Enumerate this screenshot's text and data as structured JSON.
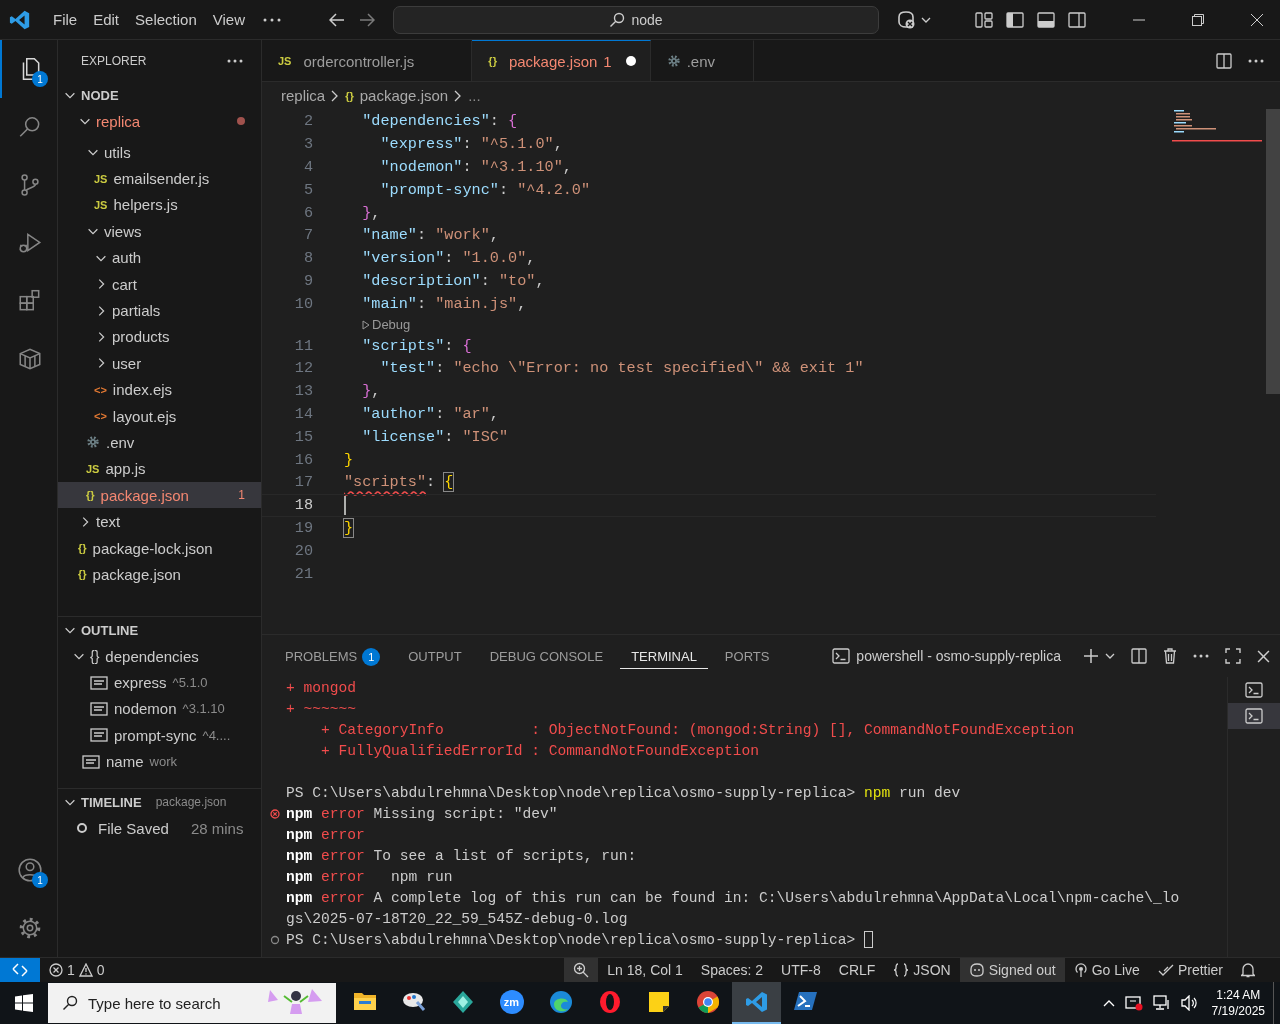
{
  "title_bar": {
    "menu": [
      "File",
      "Edit",
      "Selection",
      "View"
    ],
    "search": "node"
  },
  "activity_bar": {
    "top": [
      {
        "kind": "explorer",
        "selected": true,
        "badge": "1"
      },
      {
        "kind": "search",
        "selected": false
      },
      {
        "kind": "source-control",
        "selected": false
      },
      {
        "kind": "run-debug",
        "selected": false
      },
      {
        "kind": "extensions",
        "selected": false
      },
      {
        "kind": "box",
        "selected": false
      }
    ],
    "bottom": [
      {
        "kind": "accounts",
        "badge": "1"
      },
      {
        "kind": "settings"
      }
    ]
  },
  "explorer": {
    "title": "EXPLORER",
    "section": {
      "label": "NODE",
      "expanded": true
    },
    "tree": [
      {
        "label": "replica",
        "kind": "folder",
        "expanded": true,
        "selected": false,
        "error": true,
        "children": [
          {
            "label": "utils",
            "kind": "folder",
            "expanded": true,
            "selected": false,
            "error": false,
            "children": [
              {
                "label": "emailsender.js",
                "kind": "js",
                "icon": "JS",
                "selected": false,
                "error": false
              },
              {
                "label": "helpers.js",
                "kind": "js",
                "icon": "JS",
                "selected": false,
                "error": false
              }
            ]
          },
          {
            "label": "views",
            "kind": "folder",
            "expanded": true,
            "selected": false,
            "error": false,
            "children": [
              {
                "label": "auth",
                "kind": "folder",
                "expanded": true,
                "selected": false,
                "error": false
              },
              {
                "label": "cart",
                "kind": "folder",
                "expanded": false,
                "selected": false,
                "error": false
              },
              {
                "label": "partials",
                "kind": "folder",
                "expanded": false,
                "selected": false,
                "error": false
              },
              {
                "label": "products",
                "kind": "folder",
                "expanded": false,
                "selected": false,
                "error": false
              },
              {
                "label": "user",
                "kind": "folder",
                "expanded": false,
                "selected": false,
                "error": false
              },
              {
                "label": "index.ejs",
                "kind": "ejs",
                "icon": "<>",
                "selected": false,
                "error": false
              },
              {
                "label": "layout.ejs",
                "kind": "ejs",
                "icon": "<>",
                "selected": false,
                "error": false
              }
            ]
          },
          {
            "label": ".env",
            "kind": "env",
            "selected": false,
            "error": false
          },
          {
            "label": "app.js",
            "kind": "js",
            "icon": "JS",
            "selected": false,
            "error": false
          },
          {
            "label": "package.json",
            "kind": "json",
            "icon": "{}",
            "selected": true,
            "error": true,
            "count": "1"
          }
        ]
      },
      {
        "label": "text",
        "kind": "folder",
        "expanded": false,
        "selected": false,
        "error": false
      },
      {
        "label": "package-lock.json",
        "kind": "json",
        "icon": "{}",
        "selected": false,
        "error": false
      },
      {
        "label": "package.json",
        "kind": "json",
        "icon": "{}",
        "selected": false,
        "error": false
      }
    ]
  },
  "outline": {
    "title": "OUTLINE",
    "expanded": true,
    "items": [
      {
        "label": "dependencies",
        "kind": "object",
        "icon": "{}",
        "expanded": true,
        "children": [
          {
            "label": "express",
            "detail": "^5.1.0",
            "kind": "string"
          },
          {
            "label": "nodemon",
            "detail": "^3.1.10",
            "kind": "string"
          },
          {
            "label": "prompt-sync",
            "detail": "^4....",
            "kind": "string"
          }
        ]
      },
      {
        "label": "name",
        "detail": "work",
        "kind": "string"
      }
    ]
  },
  "timeline": {
    "title": "TIMELINE",
    "expanded": true,
    "file": "package.json",
    "entries": [
      {
        "label": "File Saved",
        "time": "28 mins"
      }
    ]
  },
  "editor": {
    "tabs": [
      {
        "label": "ordercontroller.js",
        "kind": "js",
        "icon": "JS",
        "selected": false,
        "modified": false,
        "error": false
      },
      {
        "label": "package.json",
        "count": "1",
        "kind": "json",
        "icon": "{}",
        "selected": true,
        "modified": true,
        "error": true
      },
      {
        "label": ".env",
        "kind": "env",
        "selected": false,
        "modified": false,
        "error": false
      }
    ],
    "breadcrumb": [
      {
        "label": "replica",
        "kind": "folder"
      },
      {
        "label": "package.json",
        "kind": "json",
        "icon": "{}"
      },
      {
        "label": "...",
        "kind": "more"
      }
    ],
    "lines": [
      {
        "kind": "code",
        "num": "2",
        "current": false,
        "tokens": [
          {
            "kind": "key",
            "text": "  \"dependencies\""
          },
          {
            "kind": "punc",
            "text": ": "
          },
          {
            "kind": "b2",
            "text": "{"
          }
        ]
      },
      {
        "kind": "code",
        "num": "3",
        "current": false,
        "tokens": [
          {
            "kind": "key",
            "text": "    \"express\""
          },
          {
            "kind": "punc",
            "text": ": "
          },
          {
            "kind": "str",
            "text": "\"^5.1.0\""
          },
          {
            "kind": "punc",
            "text": ","
          }
        ]
      },
      {
        "kind": "code",
        "num": "4",
        "current": false,
        "tokens": [
          {
            "kind": "key",
            "text": "    \"nodemon\""
          },
          {
            "kind": "punc",
            "text": ": "
          },
          {
            "kind": "str",
            "text": "\"^3.1.10\""
          },
          {
            "kind": "punc",
            "text": ","
          }
        ]
      },
      {
        "kind": "code",
        "num": "5",
        "current": false,
        "tokens": [
          {
            "kind": "key",
            "text": "    \"prompt-sync\""
          },
          {
            "kind": "punc",
            "text": ": "
          },
          {
            "kind": "str",
            "text": "\"^4.2.0\""
          }
        ]
      },
      {
        "kind": "code",
        "num": "6",
        "current": false,
        "tokens": [
          {
            "kind": "b2",
            "text": "  }"
          },
          {
            "kind": "punc",
            "text": ","
          }
        ]
      },
      {
        "kind": "code",
        "num": "7",
        "current": false,
        "tokens": [
          {
            "kind": "key",
            "text": "  \"name\""
          },
          {
            "kind": "punc",
            "text": ": "
          },
          {
            "kind": "str",
            "text": "\"work\""
          },
          {
            "kind": "punc",
            "text": ","
          }
        ]
      },
      {
        "kind": "code",
        "num": "8",
        "current": false,
        "tokens": [
          {
            "kind": "key",
            "text": "  \"version\""
          },
          {
            "kind": "punc",
            "text": ": "
          },
          {
            "kind": "str",
            "text": "\"1.0.0\""
          },
          {
            "kind": "punc",
            "text": ","
          }
        ]
      },
      {
        "kind": "code",
        "num": "9",
        "current": false,
        "tokens": [
          {
            "kind": "key",
            "text": "  \"description\""
          },
          {
            "kind": "punc",
            "text": ": "
          },
          {
            "kind": "str",
            "text": "\"to\""
          },
          {
            "kind": "punc",
            "text": ","
          }
        ]
      },
      {
        "kind": "code",
        "num": "10",
        "current": false,
        "tokens": [
          {
            "kind": "key",
            "text": "  \"main\""
          },
          {
            "kind": "punc",
            "text": ": "
          },
          {
            "kind": "str",
            "text": "\"main.js\""
          },
          {
            "kind": "punc",
            "text": ","
          }
        ]
      },
      {
        "kind": "lens",
        "label": "Debug"
      },
      {
        "kind": "code",
        "num": "11",
        "current": false,
        "tokens": [
          {
            "kind": "key",
            "text": "  \"scripts\""
          },
          {
            "kind": "punc",
            "text": ": "
          },
          {
            "kind": "b2",
            "text": "{"
          }
        ]
      },
      {
        "kind": "code",
        "num": "12",
        "current": false,
        "tokens": [
          {
            "kind": "key",
            "text": "    \"test\""
          },
          {
            "kind": "punc",
            "text": ": "
          },
          {
            "kind": "str",
            "text": "\"echo \\\"Error: no test specified\\\" && exit 1\""
          }
        ]
      },
      {
        "kind": "code",
        "num": "13",
        "current": false,
        "tokens": [
          {
            "kind": "b2",
            "text": "  }"
          },
          {
            "kind": "punc",
            "text": ","
          }
        ]
      },
      {
        "kind": "code",
        "num": "14",
        "current": false,
        "tokens": [
          {
            "kind": "key",
            "text": "  \"author\""
          },
          {
            "kind": "punc",
            "text": ": "
          },
          {
            "kind": "str",
            "text": "\"ar\""
          },
          {
            "kind": "punc",
            "text": ","
          }
        ]
      },
      {
        "kind": "code",
        "num": "15",
        "current": false,
        "tokens": [
          {
            "kind": "key",
            "text": "  \"license\""
          },
          {
            "kind": "punc",
            "text": ": "
          },
          {
            "kind": "str",
            "text": "\"ISC\""
          }
        ]
      },
      {
        "kind": "code",
        "num": "16",
        "current": false,
        "tokens": [
          {
            "kind": "b1",
            "text": "}"
          }
        ]
      },
      {
        "kind": "code",
        "num": "17",
        "current": false,
        "tokens": [
          {
            "kind": "errstr",
            "text": "\"scripts\""
          },
          {
            "kind": "punc",
            "text": ": "
          },
          {
            "kind": "match",
            "text": "{"
          }
        ]
      },
      {
        "kind": "code",
        "num": "18",
        "current": true
      },
      {
        "kind": "code",
        "num": "19",
        "current": false,
        "tokens": [
          {
            "kind": "match",
            "text": "}"
          }
        ]
      },
      {
        "kind": "code",
        "num": "20",
        "current": false
      },
      {
        "kind": "code",
        "num": "21",
        "current": false
      }
    ]
  },
  "panel": {
    "tabs": [
      {
        "label": "PROBLEMS",
        "badge": "1",
        "selected": false
      },
      {
        "label": "OUTPUT",
        "selected": false
      },
      {
        "label": "DEBUG CONSOLE",
        "selected": false
      },
      {
        "label": "TERMINAL",
        "selected": true
      },
      {
        "label": "PORTS",
        "selected": false
      }
    ],
    "terminal_name": "powershell - osmo-supply-replica",
    "terminals": [
      {
        "selected": false
      },
      {
        "selected": true
      }
    ],
    "lines": [
      {
        "kind": "plain",
        "segments": [
          {
            "kind": "err",
            "text": "+ mongod"
          }
        ]
      },
      {
        "kind": "plain",
        "segments": [
          {
            "kind": "err",
            "text": "+ ~~~~~~"
          }
        ]
      },
      {
        "kind": "plain",
        "segments": [
          {
            "kind": "err",
            "text": "    + CategoryInfo          : ObjectNotFound: (mongod:String) [], CommandNotFoundException"
          }
        ]
      },
      {
        "kind": "plain",
        "segments": [
          {
            "kind": "err",
            "text": "    + FullyQualifiedErrorId : CommandNotFoundException"
          }
        ]
      },
      {
        "kind": "plain"
      },
      {
        "kind": "plain",
        "segments": [
          {
            "kind": "text",
            "text": "PS C:\\Users\\abdulrehmna\\Desktop\\node\\replica\\osmo-supply-replica> "
          },
          {
            "kind": "cmd",
            "text": "npm"
          },
          {
            "kind": "text",
            "text": " run dev"
          }
        ]
      },
      {
        "kind": "error",
        "segments": [
          {
            "kind": "bold",
            "text": "npm"
          },
          {
            "kind": "err",
            "text": " error"
          },
          {
            "kind": "text",
            "text": " Missing script: \"dev\""
          }
        ]
      },
      {
        "kind": "plain",
        "segments": [
          {
            "kind": "bold",
            "text": "npm"
          },
          {
            "kind": "err",
            "text": " error"
          }
        ]
      },
      {
        "kind": "plain",
        "segments": [
          {
            "kind": "bold",
            "text": "npm"
          },
          {
            "kind": "err",
            "text": " error"
          },
          {
            "kind": "text",
            "text": " To see a list of scripts, run:"
          }
        ]
      },
      {
        "kind": "plain",
        "segments": [
          {
            "kind": "bold",
            "text": "npm"
          },
          {
            "kind": "err",
            "text": " error"
          },
          {
            "kind": "text",
            "text": "   npm run"
          }
        ]
      },
      {
        "kind": "plain",
        "segments": [
          {
            "kind": "bold",
            "text": "npm"
          },
          {
            "kind": "err",
            "text": " error"
          },
          {
            "kind": "text",
            "text": " A complete log of this run can be found in: C:\\Users\\abdulrehmna\\AppData\\Local\\npm-cache\\_lo"
          }
        ]
      },
      {
        "kind": "plain",
        "segments": [
          {
            "kind": "text",
            "text": "gs\\2025-07-18T20_22_59_545Z-debug-0.log"
          }
        ]
      },
      {
        "kind": "prompt",
        "cursor": true,
        "segments": [
          {
            "kind": "text",
            "text": "PS C:\\Users\\abdulrehmna\\Desktop\\node\\replica\\osmo-supply-replica> "
          }
        ]
      }
    ]
  },
  "status_bar": {
    "errors": "1",
    "warnings": "0",
    "items": [
      {
        "kind": "zoom",
        "highlighted": true
      },
      {
        "kind": "text",
        "label": "Ln 18, Col 1",
        "highlighted": false
      },
      {
        "kind": "text",
        "label": "Spaces: 2",
        "highlighted": false
      },
      {
        "kind": "text",
        "label": "UTF-8",
        "highlighted": false
      },
      {
        "kind": "text",
        "label": "CRLF",
        "highlighted": false
      },
      {
        "kind": "language",
        "label": "JSON",
        "highlighted": false
      },
      {
        "kind": "account",
        "label": "Signed out",
        "highlighted": true
      },
      {
        "kind": "live",
        "label": "Go Live",
        "highlighted": false
      },
      {
        "kind": "prettier",
        "label": "Prettier",
        "highlighted": false
      },
      {
        "kind": "bell",
        "highlighted": false
      }
    ]
  },
  "taskbar": {
    "search": "Type here to search",
    "apps": [
      {
        "kind": "files",
        "selected": false
      },
      {
        "kind": "paint",
        "selected": false
      },
      {
        "kind": "diamond",
        "selected": false
      },
      {
        "kind": "zoom",
        "label": "zm",
        "selected": false
      },
      {
        "kind": "edge",
        "selected": false
      },
      {
        "kind": "opera",
        "selected": false
      },
      {
        "kind": "notes",
        "selected": false
      },
      {
        "kind": "chrome",
        "selected": false
      },
      {
        "kind": "vscode",
        "selected": true
      },
      {
        "kind": "powershell",
        "selected": false
      }
    ],
    "time": "1:24 AM",
    "date": "7/19/2025"
  }
}
